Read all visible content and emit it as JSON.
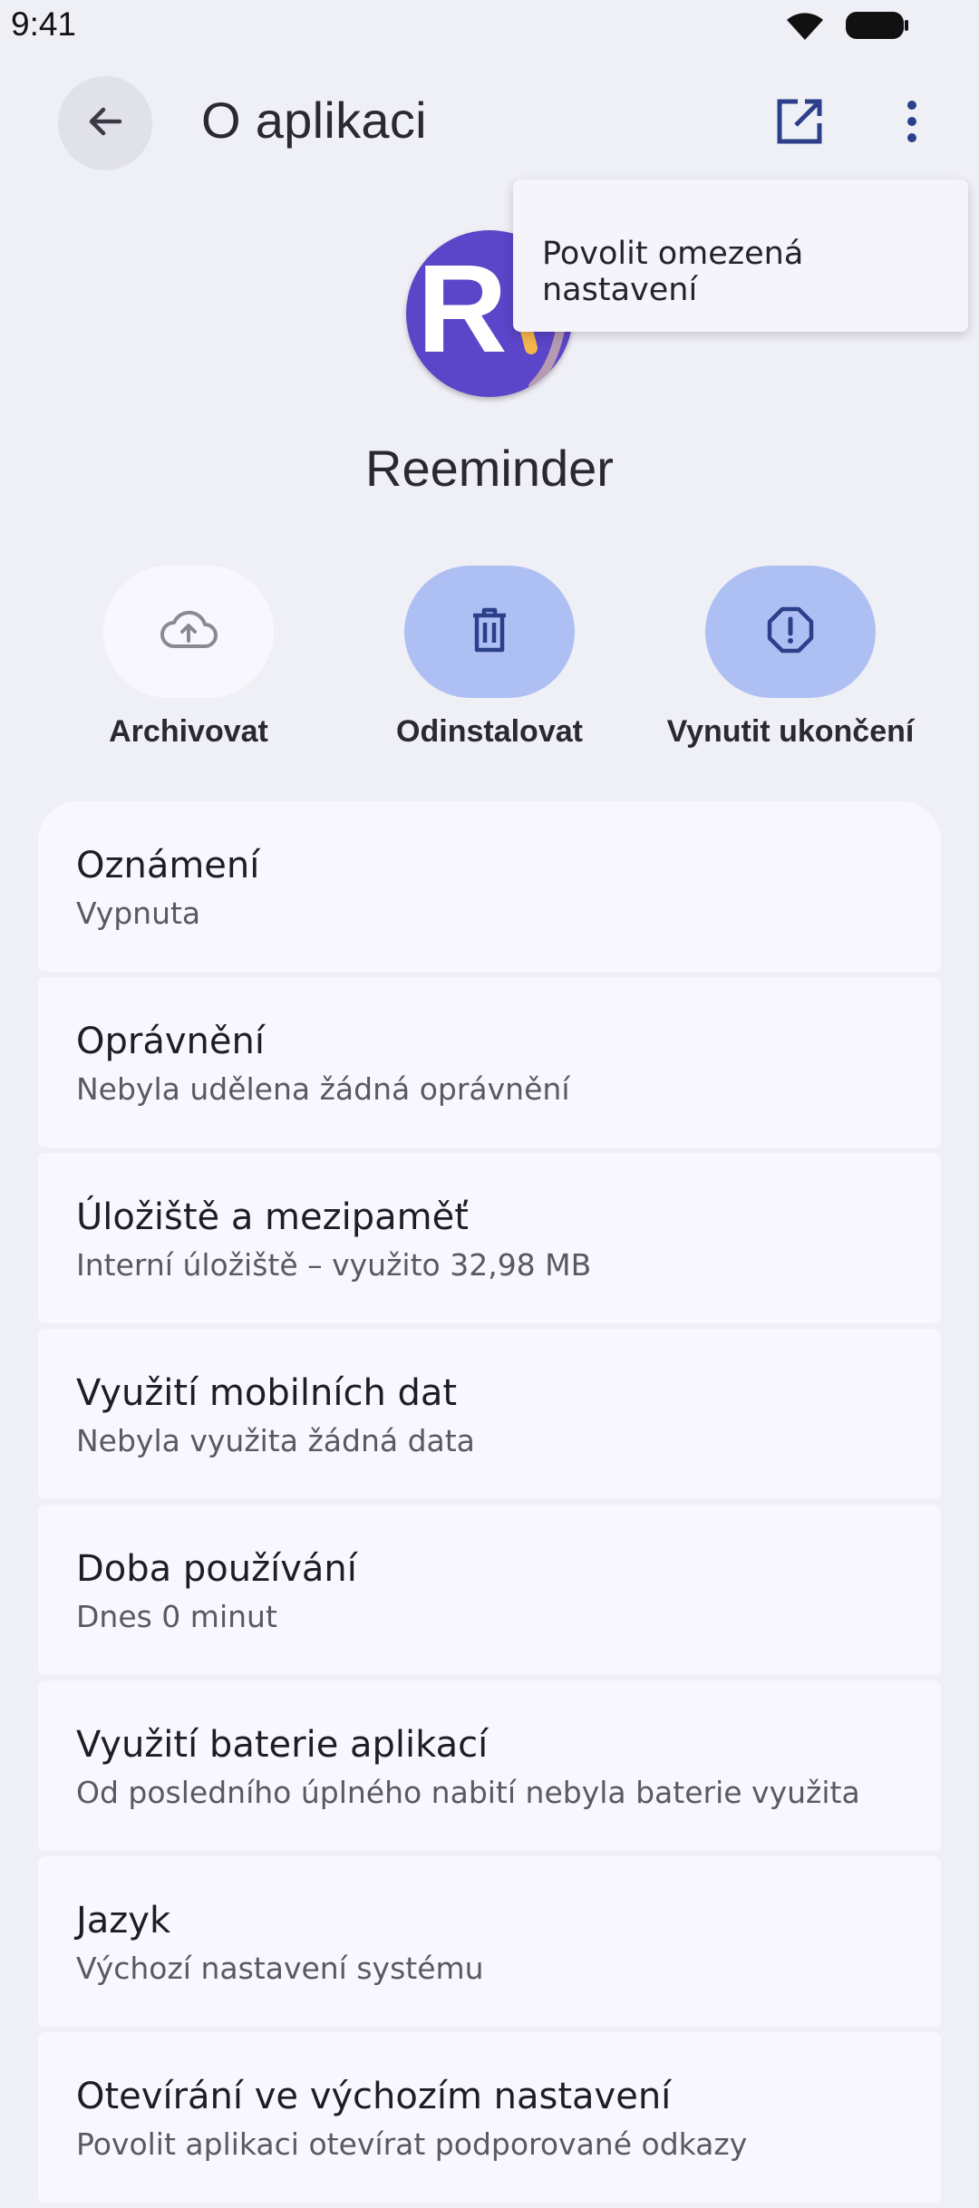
{
  "status_bar": {
    "time": "9:41"
  },
  "app_bar": {
    "title": "O aplikaci"
  },
  "app": {
    "name": "Reeminder",
    "icon_letter": "R",
    "icon_color": "#5b45c8"
  },
  "actions": [
    {
      "label": "Archivovat",
      "icon": "cloud-upload-icon"
    },
    {
      "label": "Odinstalovat",
      "icon": "trash-icon"
    },
    {
      "label": "Vynutit ukončení",
      "icon": "alert-octagon-icon"
    }
  ],
  "settings": [
    {
      "title": "Oznámení",
      "subtitle": "Vypnuta"
    },
    {
      "title": "Oprávnění",
      "subtitle": "Nebyla udělena žádná oprávnění"
    },
    {
      "title": "Úložiště a mezipaměť",
      "subtitle": "Interní úložiště – využito 32,98 MB"
    },
    {
      "title": "Využití mobilních dat",
      "subtitle": "Nebyla využita žádná data"
    },
    {
      "title": "Doba používání",
      "subtitle": "Dnes 0 minut"
    },
    {
      "title": "Využití baterie aplikací",
      "subtitle": "Od posledního úplného nabití nebyla baterie využita"
    },
    {
      "title": "Jazyk",
      "subtitle": "Výchozí nastavení systému"
    },
    {
      "title": "Otevírání ve výchozím nastavení",
      "subtitle": "Povolit aplikaci otevírat podporované odkazy"
    }
  ],
  "overflow_menu": {
    "items": [
      "Povolit omezená nastavení"
    ]
  },
  "colors": {
    "background": "#efeff6",
    "card": "#f8f7fd",
    "accent_pill": "#aebff3",
    "accent_icon": "#2b3f8a"
  }
}
